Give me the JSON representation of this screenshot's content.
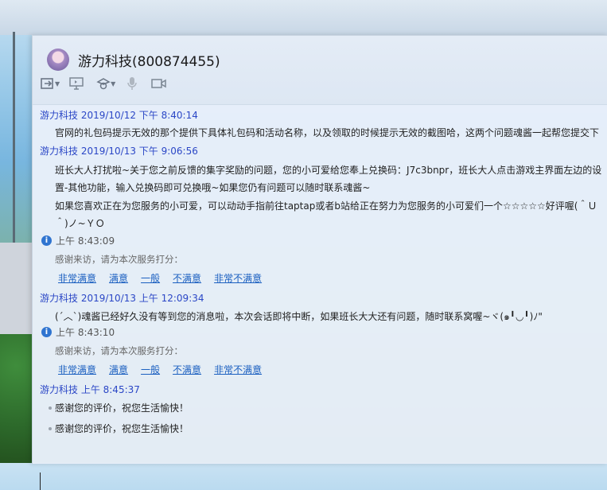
{
  "window": {
    "title": "游力科技(800874455)"
  },
  "toolbar": {
    "icons": [
      "transfer-icon",
      "screen-share-icon",
      "remote-assist-icon",
      "microphone-icon",
      "video-icon"
    ]
  },
  "messages": {
    "m1": {
      "header": "游力科技 2019/10/12 下午 8:40:14",
      "text": "官网的礼包码提示无效的那个提供下具体礼包码和活动名称，以及领取的时候提示无效的截图哈，这两个问题魂酱一起帮您提交下"
    },
    "m2": {
      "header": "游力科技 2019/10/13 下午 9:06:56",
      "line1": "班长大人打扰啦~关于您之前反馈的集字奖励的问题，您的小可爱给您奉上兑换码：J7c3bnpr，班长大人点击游戏主界面左边的设",
      "line2": "置-其他功能，输入兑换码即可兑换哦~如果您仍有问题可以随时联系魂酱~",
      "line3": "如果您喜欢正在为您服务的小可爱，可以动动手指前往taptap或者b站给正在努力为您服务的小可爱们一个☆☆☆☆☆好评喔(＾Ｕ",
      "line4": "＾)ノ~ＹＯ"
    },
    "s1": {
      "time": "上午 8:43:09",
      "prompt": "感谢来访，请为本次服务打分：",
      "ratings": [
        "非常满意",
        "满意",
        "一般",
        "不满意",
        "非常不满意"
      ]
    },
    "m3": {
      "header": "游力科技 2019/10/13 上午 12:09:34",
      "text": "(ˊ︿ˋ)魂酱已经好久没有等到您的消息啦，本次会话即将中断，如果班长大大还有问题，随时联系窝喔~ヾ(๑╹◡╹)ﾉ\""
    },
    "s2": {
      "time": "上午 8:43:10",
      "prompt": "感谢来访，请为本次服务打分：",
      "ratings": [
        "非常满意",
        "满意",
        "一般",
        "不满意",
        "非常不满意"
      ]
    },
    "m4": {
      "header": "游力科技  上午 8:45:37",
      "items": [
        "感谢您的评价，祝您生活愉快！",
        "感谢您的评价，祝您生活愉快！"
      ]
    }
  }
}
